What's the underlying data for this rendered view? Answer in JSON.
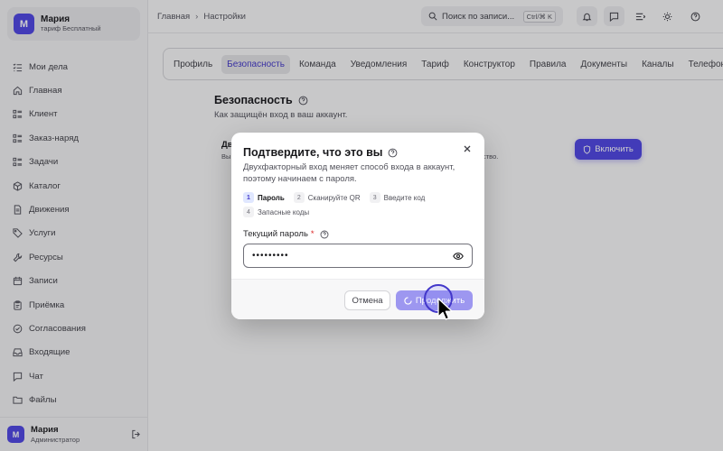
{
  "account": {
    "initial": "М",
    "name": "Мария",
    "plan": "тариф Бесплатный"
  },
  "nav": [
    {
      "label": "Мои дела",
      "icon": "list-check-icon"
    },
    {
      "label": "Главная",
      "icon": "home-icon"
    },
    {
      "label": "Клиент",
      "icon": "grid-list-icon"
    },
    {
      "label": "Заказ-наряд",
      "icon": "grid-list-icon"
    },
    {
      "label": "Задачи",
      "icon": "grid-list-icon"
    },
    {
      "label": "Каталог",
      "icon": "box-icon"
    },
    {
      "label": "Движения",
      "icon": "document-icon"
    },
    {
      "label": "Услуги",
      "icon": "tag-icon"
    },
    {
      "label": "Ресурсы",
      "icon": "wrench-icon"
    },
    {
      "label": "Записи",
      "icon": "calendar-icon"
    },
    {
      "label": "Приёмка",
      "icon": "clipboard-icon"
    },
    {
      "label": "Согласования",
      "icon": "check-circle-icon"
    },
    {
      "label": "Входящие",
      "icon": "inbox-icon"
    },
    {
      "label": "Чат",
      "icon": "chat-icon"
    },
    {
      "label": "Файлы",
      "icon": "folder-icon"
    }
  ],
  "user": {
    "initial": "М",
    "name": "Мария",
    "role": "Администратор"
  },
  "breadcrumb": {
    "home": "Главная",
    "current": "Настройки"
  },
  "search": {
    "placeholder": "Поиск по записи...",
    "shortcut": "Ctrl/⌘ K"
  },
  "tabs": [
    {
      "label": "Профиль",
      "active": false
    },
    {
      "label": "Безопасность",
      "active": true
    },
    {
      "label": "Команда",
      "active": false
    },
    {
      "label": "Уведомления",
      "active": false
    },
    {
      "label": "Тариф",
      "active": false
    },
    {
      "label": "Конструктор",
      "active": false
    },
    {
      "label": "Правила",
      "active": false
    },
    {
      "label": "Документы",
      "active": false
    },
    {
      "label": "Каналы",
      "active": false
    },
    {
      "label": "Телефония",
      "active": false
    }
  ],
  "section": {
    "title": "Безопасность",
    "subtitle": "Как защищён вход в ваш аккаунт.",
    "card_title_fragment": "Дв",
    "card_text_fragment": "Вы",
    "card_text_tail": "ство.",
    "enable_label": "Включить"
  },
  "modal": {
    "title": "Подтвердите, что это вы",
    "description": "Двухфакторный вход меняет способ входа в аккаунт, поэтому начинаем с пароля.",
    "steps": [
      {
        "num": "1",
        "label": "Пароль",
        "active": true
      },
      {
        "num": "2",
        "label": "Сканируйте QR",
        "active": false
      },
      {
        "num": "3",
        "label": "Введите код",
        "active": false
      },
      {
        "num": "4",
        "label": "Запасные коды",
        "active": false
      }
    ],
    "field_label": "Текущий пароль",
    "required_mark": "*",
    "password_value": "•••••••••",
    "cancel_label": "Отмена",
    "continue_label": "Продолжить"
  },
  "colors": {
    "accent": "#4f46e5",
    "accent_disabled": "#9d97f0",
    "required": "#dc2626"
  }
}
